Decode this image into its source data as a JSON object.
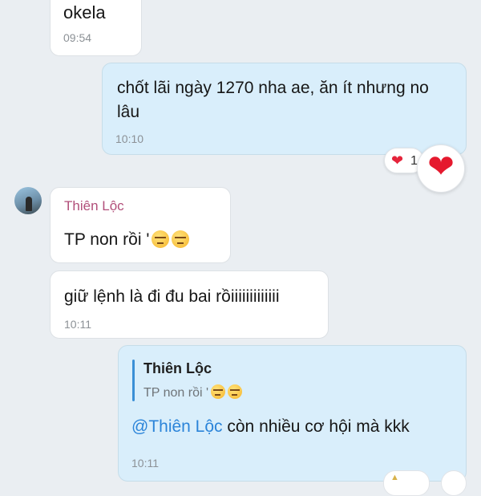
{
  "messages": [
    {
      "text": "okela",
      "time": "09:54"
    },
    {
      "text": "chốt lãi ngày 1270 nha ae, ăn ít nhưng no lâu",
      "time": "10:10"
    },
    {
      "sender": "Thiên Lộc",
      "text": "TP non rồi '",
      "emojis": [
        "unamused-face-icon",
        "unamused-face-icon"
      ]
    },
    {
      "text": "giữ lệnh là đi đu bai rồiiiiiiiiiiiii",
      "time": "10:11"
    },
    {
      "quote": {
        "sender": "Thiên Lộc",
        "text": "TP non rồi '"
      },
      "mention": "@Thiên Lộc",
      "text": " còn nhiều cơ hội mà kkk",
      "time": "10:11"
    }
  ],
  "reaction": {
    "icon": "heart-icon",
    "count": "1"
  },
  "colors": {
    "background": "#eaeef2",
    "incoming_bubble": "#ffffff",
    "outgoing_bubble": "#d9eefb",
    "sender_name": "#b24f7a",
    "mention": "#2b84d9",
    "heart": "#e5243b"
  }
}
